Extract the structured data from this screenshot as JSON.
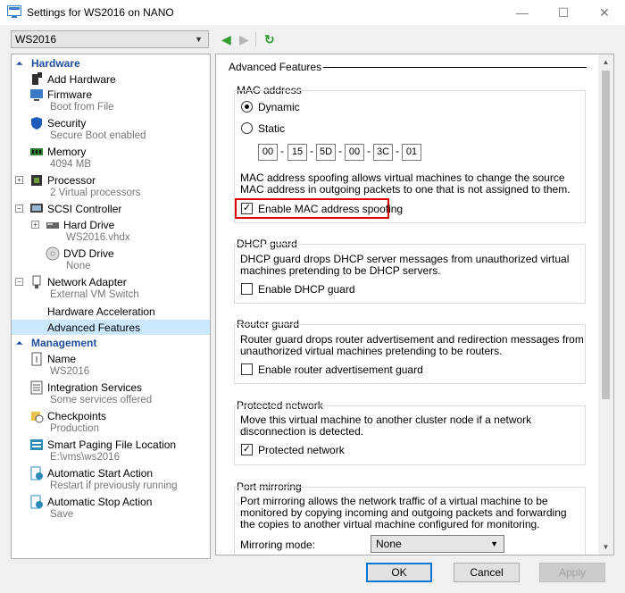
{
  "window": {
    "title": "Settings for WS2016 on NANO",
    "minimize": "—",
    "maximize": "☐",
    "close": "✕"
  },
  "toolbar": {
    "vm_name": "WS2016",
    "back": "◀",
    "forward": "▶",
    "refresh": "↻"
  },
  "sidebar": {
    "hardware_header": "Hardware",
    "management_header": "Management",
    "items": [
      {
        "label": "Add Hardware",
        "sub": ""
      },
      {
        "label": "Firmware",
        "sub": "Boot from File"
      },
      {
        "label": "Security",
        "sub": "Secure Boot enabled"
      },
      {
        "label": "Memory",
        "sub": "4094 MB"
      },
      {
        "label": "Processor",
        "sub": "2 Virtual processors"
      },
      {
        "label": "SCSI Controller",
        "sub": ""
      },
      {
        "label": "Hard Drive",
        "sub": "WS2016.vhdx"
      },
      {
        "label": "DVD Drive",
        "sub": "None"
      },
      {
        "label": "Network Adapter",
        "sub": "External VM Switch"
      },
      {
        "label": "Hardware Acceleration",
        "sub": ""
      },
      {
        "label": "Advanced Features",
        "sub": ""
      },
      {
        "label": "Name",
        "sub": "WS2016"
      },
      {
        "label": "Integration Services",
        "sub": "Some services offered"
      },
      {
        "label": "Checkpoints",
        "sub": "Production"
      },
      {
        "label": "Smart Paging File Location",
        "sub": "E:\\vms\\ws2016"
      },
      {
        "label": "Automatic Start Action",
        "sub": "Restart if previously running"
      },
      {
        "label": "Automatic Stop Action",
        "sub": "Save"
      }
    ]
  },
  "main": {
    "heading": "Advanced Features",
    "mac": {
      "title": "MAC address",
      "dynamic": "Dynamic",
      "static": "Static",
      "octets": [
        "00",
        "15",
        "5D",
        "00",
        "3C",
        "01"
      ],
      "spoof_desc": "MAC address spoofing allows virtual machines to change the source MAC address in outgoing packets to one that is not assigned to them.",
      "spoof_label": "Enable MAC address spoofing"
    },
    "dhcp": {
      "title": "DHCP guard",
      "desc": "DHCP guard drops DHCP server messages from unauthorized virtual machines pretending to be DHCP servers.",
      "label": "Enable DHCP guard"
    },
    "router": {
      "title": "Router guard",
      "desc": "Router guard drops router advertisement and redirection messages from unauthorized virtual machines pretending to be routers.",
      "label": "Enable router advertisement guard"
    },
    "protected": {
      "title": "Protected network",
      "desc": "Move this virtual machine to another cluster node if a network disconnection is detected.",
      "label": "Protected network"
    },
    "mirror": {
      "title": "Port mirroring",
      "desc": "Port mirroring allows the network traffic of a virtual machine to be monitored by copying incoming and outgoing packets and forwarding the copies to another virtual machine configured for monitoring.",
      "mode_label": "Mirroring mode:",
      "mode_value": "None"
    }
  },
  "buttons": {
    "ok": "OK",
    "cancel": "Cancel",
    "apply": "Apply"
  },
  "colors": {
    "accent": "#0078d7",
    "highlight": "#e00000",
    "selection": "#cce8ff",
    "header": "#1e4e9e"
  }
}
